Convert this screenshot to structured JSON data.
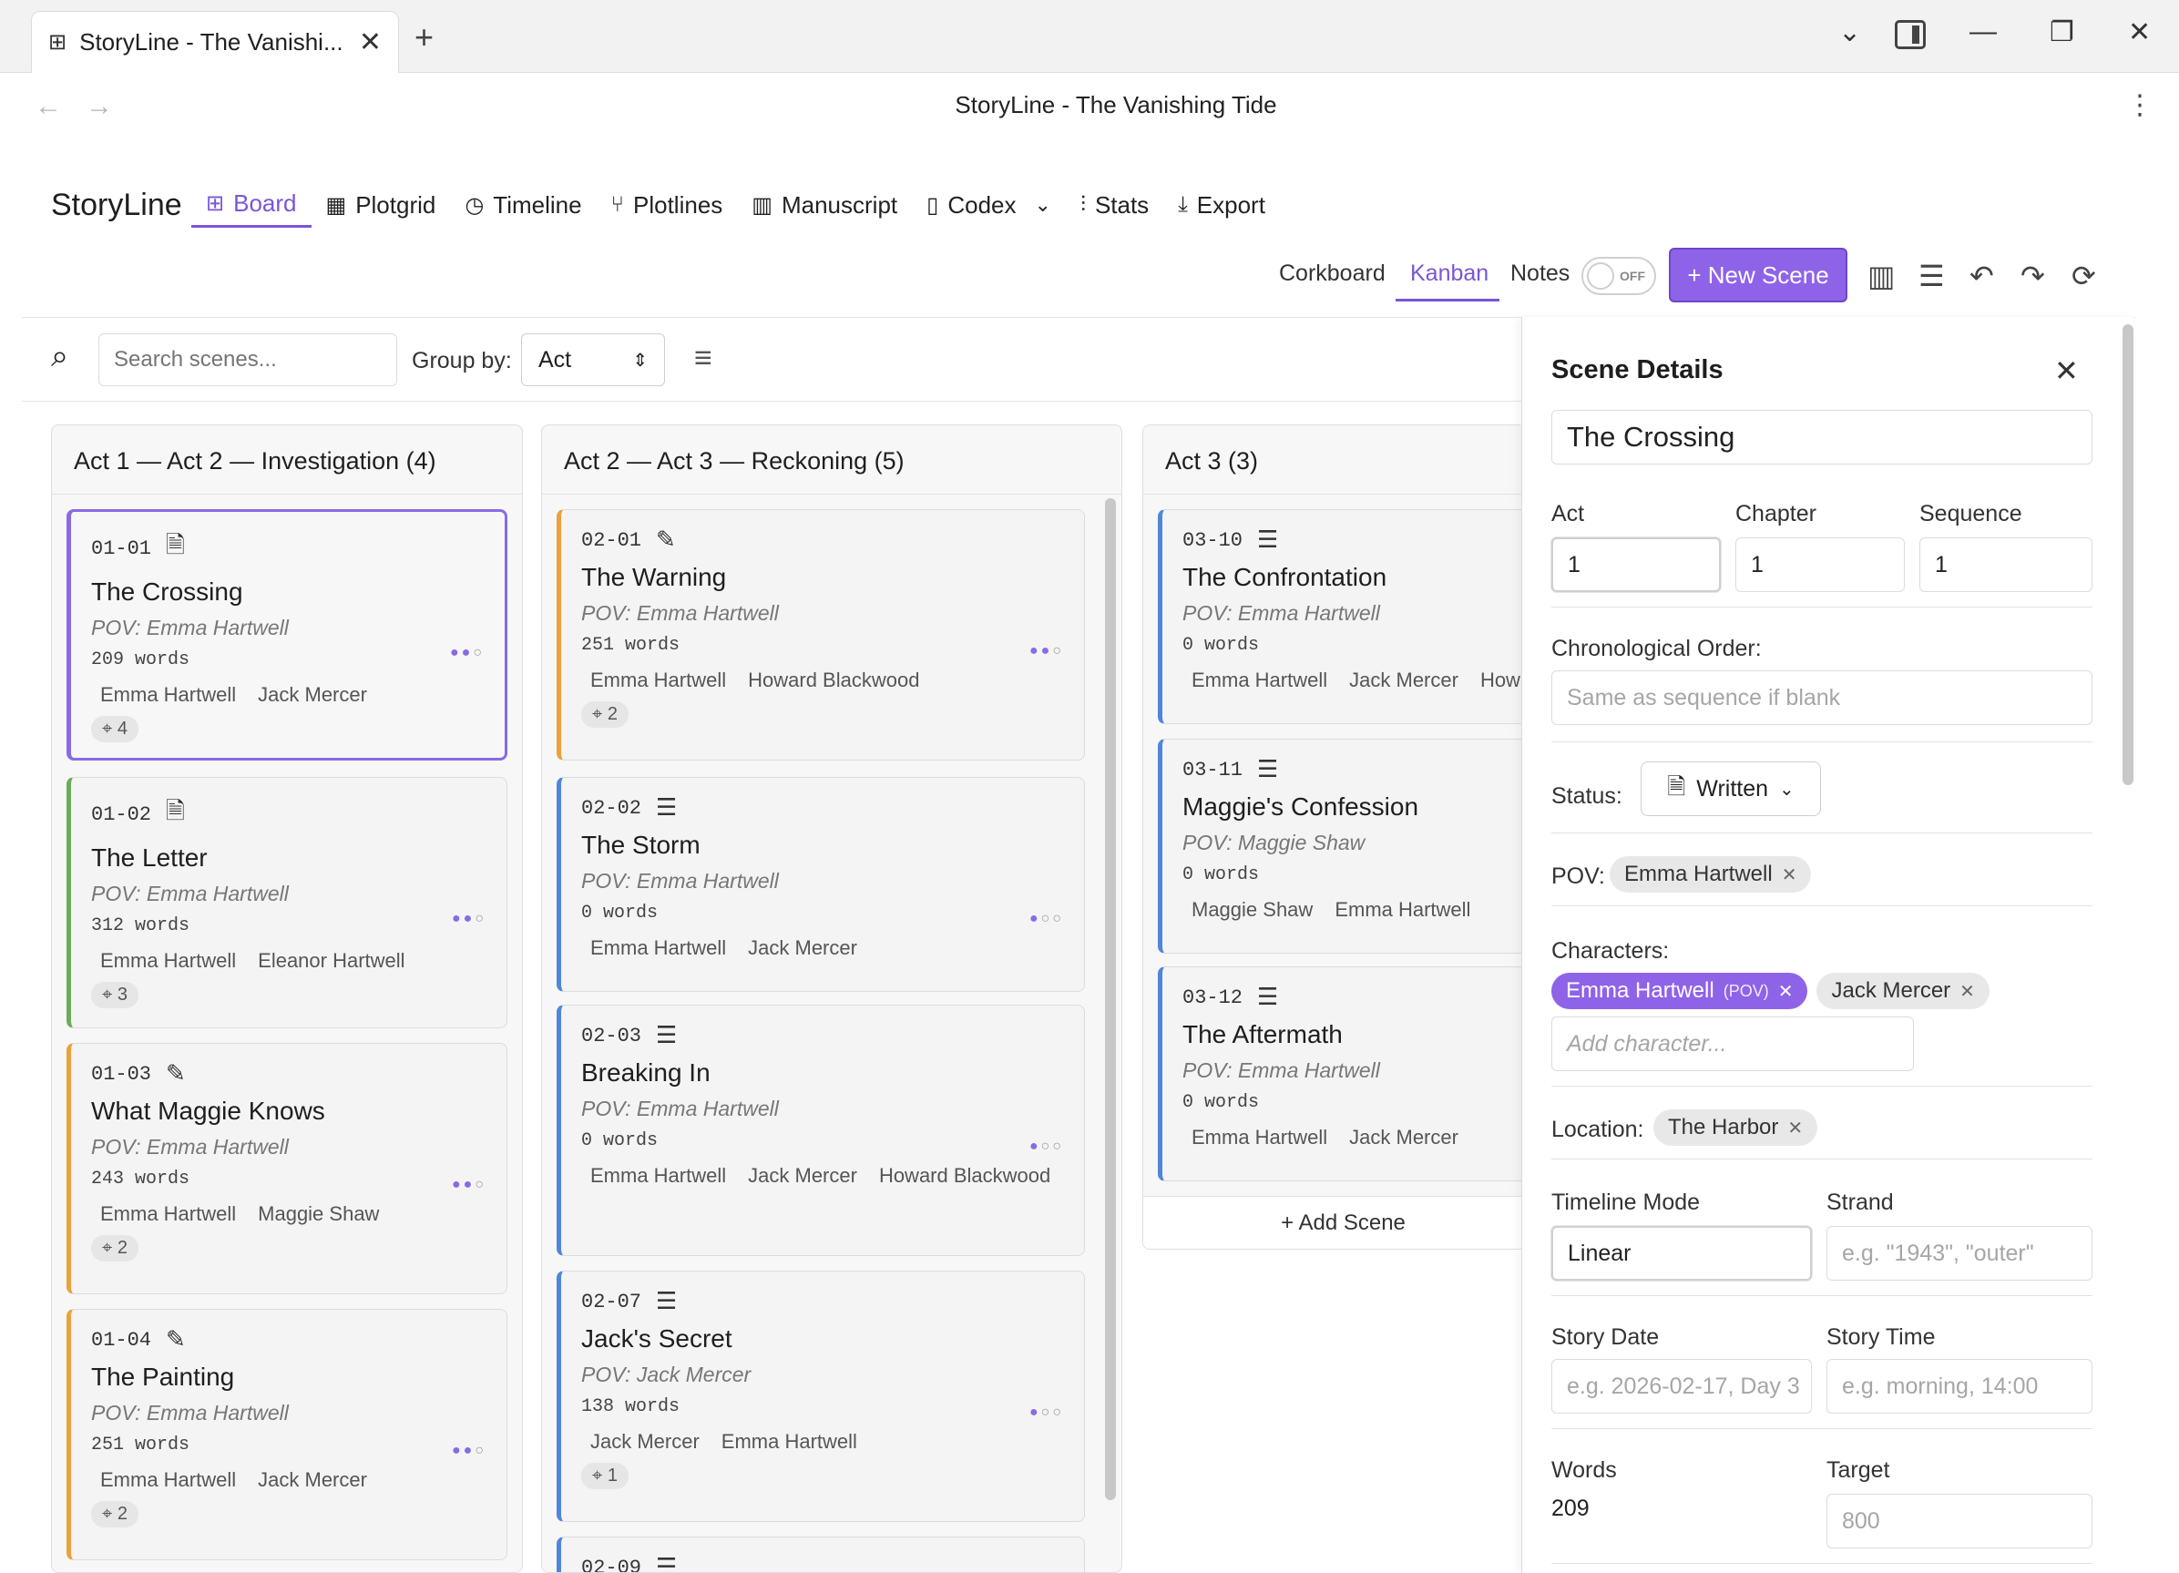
{
  "browser": {
    "tab_title": "StoryLine - The Vanishi...",
    "page_title": "StoryLine - The Vanishing Tide"
  },
  "app": {
    "brand": "StoryLine",
    "nav": [
      {
        "label": "Board",
        "icon": "grid-icon",
        "active": true
      },
      {
        "label": "Plotgrid",
        "icon": "table-icon"
      },
      {
        "label": "Timeline",
        "icon": "clock-icon"
      },
      {
        "label": "Plotlines",
        "icon": "branch-icon"
      },
      {
        "label": "Manuscript",
        "icon": "book-open-icon"
      },
      {
        "label": "Codex",
        "icon": "book-icon"
      },
      {
        "label": "Stats",
        "icon": "bar-chart-icon"
      },
      {
        "label": "Export",
        "icon": "download-icon"
      }
    ],
    "views": {
      "corkboard": "Corkboard",
      "kanban": "Kanban",
      "notes": "Notes"
    },
    "toggle_state": "OFF",
    "new_scene_label": "+ New Scene",
    "search_placeholder": "Search scenes...",
    "group_by_label": "Group by:",
    "group_by_value": "Act"
  },
  "columns": [
    {
      "title": "Act 1 — Act 2 — Investigation (4)",
      "cards": [
        {
          "num": "01-01",
          "status_icon": "document-icon",
          "title": "The Crossing",
          "pov": "POV: Emma Hartwell",
          "words": "209 words",
          "progress": 2,
          "characters": [
            "Emma Hartwell",
            "Jack Mercer"
          ],
          "badge": "4",
          "color": "#8a6ae4"
        },
        {
          "num": "01-02",
          "status_icon": "document-icon",
          "title": "The Letter",
          "pov": "POV: Emma Hartwell",
          "words": "312 words",
          "progress": 2,
          "characters": [
            "Emma Hartwell",
            "Eleanor Hartwell"
          ],
          "badge": "3",
          "color": "#6bab5a"
        },
        {
          "num": "01-03",
          "status_icon": "pencil-icon",
          "title": "What Maggie Knows",
          "pov": "POV: Emma Hartwell",
          "words": "243 words",
          "progress": 2,
          "characters": [
            "Emma Hartwell",
            "Maggie Shaw"
          ],
          "badge": "2",
          "color": "#eaa23a"
        },
        {
          "num": "01-04",
          "status_icon": "pencil-icon",
          "title": "The Painting",
          "pov": "POV: Emma Hartwell",
          "words": "251 words",
          "progress": 2,
          "characters": [
            "Emma Hartwell",
            "Jack Mercer"
          ],
          "badge": "2",
          "color": "#eaa23a"
        }
      ]
    },
    {
      "title": "Act 2 — Act 3 — Reckoning (5)",
      "cards": [
        {
          "num": "02-01",
          "status_icon": "pencil-icon",
          "title": "The Warning",
          "pov": "POV: Emma Hartwell",
          "words": "251 words",
          "progress": 2,
          "characters": [
            "Emma Hartwell",
            "Howard Blackwood"
          ],
          "badge": "2",
          "color": "#eaa23a"
        },
        {
          "num": "02-02",
          "status_icon": "list-icon",
          "title": "The Storm",
          "pov": "POV: Emma Hartwell",
          "words": "0 words",
          "progress": 1,
          "characters": [
            "Emma Hartwell",
            "Jack Mercer"
          ],
          "badge": "",
          "color": "#4f86d9"
        },
        {
          "num": "02-03",
          "status_icon": "list-icon",
          "title": "Breaking In",
          "pov": "POV: Emma Hartwell",
          "words": "0 words",
          "progress": 1,
          "characters": [
            "Emma Hartwell",
            "Jack Mercer",
            "Howard Blackwood"
          ],
          "badge": "",
          "color": "#4f86d9"
        },
        {
          "num": "02-07",
          "status_icon": "list-icon",
          "title": "Jack's Secret",
          "pov": "POV: Jack Mercer",
          "words": "138 words",
          "progress": 1,
          "characters": [
            "Jack Mercer",
            "Emma Hartwell"
          ],
          "badge": "1",
          "color": "#4f86d9"
        },
        {
          "num": "02-09",
          "status_icon": "list-icon",
          "title": "",
          "pov": "",
          "words": "",
          "progress": 0,
          "characters": [],
          "badge": "",
          "color": "#4f86d9"
        }
      ]
    },
    {
      "title": "Act 3 (3)",
      "add_scene": "+ Add Scene",
      "cards": [
        {
          "num": "03-10",
          "status_icon": "list-icon",
          "title": "The Confrontation",
          "pov": "POV: Emma Hartwell",
          "words": "0 words",
          "characters": [
            "Emma Hartwell",
            "Jack Mercer",
            "How"
          ],
          "color": "#4f86d9"
        },
        {
          "num": "03-11",
          "status_icon": "list-icon",
          "title": "Maggie's Confession",
          "pov": "POV: Maggie Shaw",
          "words": "0 words",
          "characters": [
            "Maggie Shaw",
            "Emma Hartwell"
          ],
          "color": "#4f86d9"
        },
        {
          "num": "03-12",
          "status_icon": "list-icon",
          "title": "The Aftermath",
          "pov": "POV: Emma Hartwell",
          "words": "0 words",
          "characters": [
            "Emma Hartwell",
            "Jack Mercer"
          ],
          "color": "#4f86d9"
        }
      ]
    }
  ],
  "details": {
    "heading": "Scene Details",
    "title_value": "The Crossing",
    "act_label": "Act",
    "act_value": "1",
    "chapter_label": "Chapter",
    "chapter_value": "1",
    "sequence_label": "Sequence",
    "sequence_value": "1",
    "chrono_label": "Chronological Order:",
    "chrono_placeholder": "Same as sequence if blank",
    "status_label": "Status:",
    "status_value": "Written",
    "pov_label": "POV:",
    "pov_value": "Emma Hartwell",
    "characters_label": "Characters:",
    "characters": [
      {
        "name": "Emma Hartwell",
        "tag": "(POV)"
      },
      {
        "name": "Jack Mercer",
        "tag": ""
      }
    ],
    "add_character_placeholder": "Add character...",
    "location_label": "Location:",
    "location_value": "The Harbor",
    "timeline_mode_label": "Timeline Mode",
    "timeline_mode_value": "Linear",
    "strand_label": "Strand",
    "strand_placeholder": "e.g. \"1943\", \"outer\"",
    "story_date_label": "Story Date",
    "story_date_placeholder": "e.g. 2026-02-17, Day 3",
    "story_time_label": "Story Time",
    "story_time_placeholder": "e.g. morning, 14:00",
    "words_label": "Words",
    "words_value": "209",
    "target_label": "Target",
    "target_placeholder": "800"
  }
}
